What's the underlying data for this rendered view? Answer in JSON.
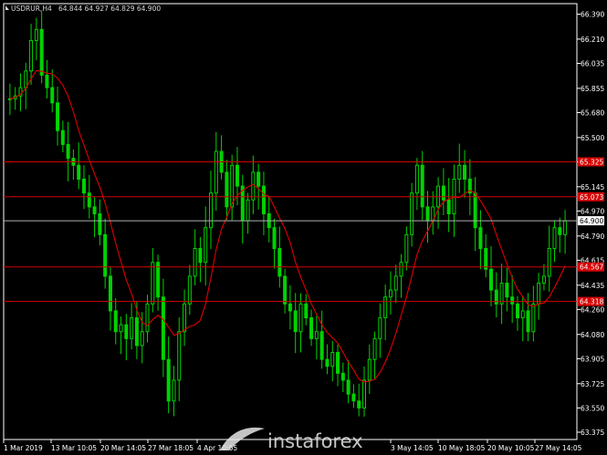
{
  "header": {
    "symbol": "USDRUR,H4",
    "ohlc": "64.844 64.927 64.829 64.900"
  },
  "watermark": "instaforex",
  "colors": {
    "background": "#000000",
    "frame": "#ffffff",
    "candle": "#00d200",
    "ma_line": "#e00000",
    "level_line": "#d40000",
    "price_line": "#b0b0b0",
    "level_label_bg": "#d40000",
    "axis_text": "#ffffff"
  },
  "chart_data": {
    "type": "candlestick",
    "y_axis": {
      "range": [
        63.375,
        66.4
      ],
      "ticks": [
        "66.390",
        "66.210",
        "66.035",
        "65.855",
        "65.680",
        "65.500",
        "65.325",
        "65.145",
        "64.970",
        "64.790",
        "64.615",
        "64.435",
        "64.260",
        "64.080",
        "63.905",
        "63.725",
        "63.550",
        "63.375"
      ]
    },
    "x_axis": {
      "labels": [
        "1 Mar 2019",
        "13 Mar 10:05",
        "20 Mar 14:05",
        "27 Mar 18:05",
        "4 Apr 10:05",
        "3 May 14:05",
        "10 May 18:05",
        "20 May 10:05",
        "27 May 14:05"
      ]
    },
    "current_price": {
      "value": 64.9,
      "label": "64.900"
    },
    "horizontal_levels": [
      {
        "value": 65.325,
        "label": "65.325"
      },
      {
        "value": 65.073,
        "label": "65.073"
      },
      {
        "value": 64.567,
        "label": "64.567"
      },
      {
        "value": 64.318,
        "label": "64.318"
      }
    ],
    "close_series": [
      65.78,
      65.8,
      65.86,
      65.98,
      66.2,
      66.28,
      65.95,
      65.86,
      65.75,
      65.55,
      65.45,
      65.35,
      65.3,
      65.2,
      65.1,
      65.0,
      64.95,
      64.8,
      64.5,
      64.25,
      64.1,
      64.15,
      64.05,
      64.2,
      64.0,
      64.1,
      64.3,
      64.6,
      64.35,
      63.9,
      63.6,
      63.75,
      64.1,
      64.3,
      64.5,
      64.7,
      64.6,
      64.85,
      65.1,
      65.4,
      65.25,
      65.0,
      65.3,
      65.15,
      64.9,
      65.05,
      65.25,
      65.15,
      64.95,
      64.85,
      64.7,
      64.5,
      64.3,
      64.25,
      64.1,
      64.3,
      64.2,
      64.05,
      64.1,
      63.9,
      63.85,
      63.95,
      63.8,
      63.75,
      63.65,
      63.6,
      63.55,
      63.75,
      63.9,
      64.05,
      64.2,
      64.35,
      64.4,
      64.5,
      64.6,
      64.8,
      65.1,
      65.3,
      65.0,
      64.9,
      65.0,
      65.15,
      65.05,
      64.95,
      65.2,
      65.3,
      65.2,
      65.1,
      64.85,
      64.7,
      64.55,
      64.4,
      64.3,
      64.45,
      64.35,
      64.3,
      64.2,
      64.25,
      64.1,
      64.3,
      64.45,
      64.5,
      64.7,
      64.85,
      64.8,
      64.9
    ]
  }
}
